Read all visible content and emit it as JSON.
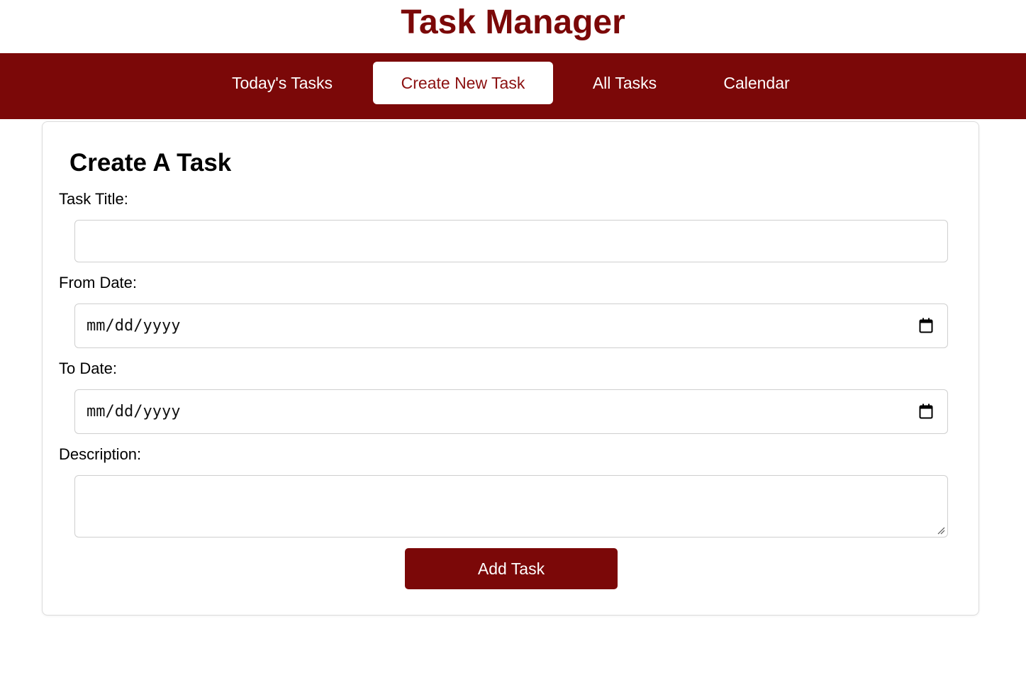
{
  "header": {
    "title": "Task Manager"
  },
  "nav": {
    "items": [
      {
        "label": "Today's Tasks"
      },
      {
        "label": "Create New Task"
      },
      {
        "label": "All Tasks"
      },
      {
        "label": "Calendar"
      }
    ],
    "active": "Create New Task"
  },
  "form": {
    "heading": "Create A Task",
    "task_title": {
      "label": "Task Title:",
      "value": ""
    },
    "from_date": {
      "label": "From Date:",
      "placeholder": "mm/dd/yyyy"
    },
    "to_date": {
      "label": "To Date:",
      "placeholder": "mm/dd/yyyy"
    },
    "description": {
      "label": "Description:",
      "value": ""
    },
    "submit_label": "Add Task"
  },
  "colors": {
    "brand": "#7b0808",
    "active_text": "#8b1010",
    "background": "#ffffff"
  },
  "icons": {
    "date_picker": "calendar-icon",
    "textarea_resize": "resize-handle-icon"
  }
}
